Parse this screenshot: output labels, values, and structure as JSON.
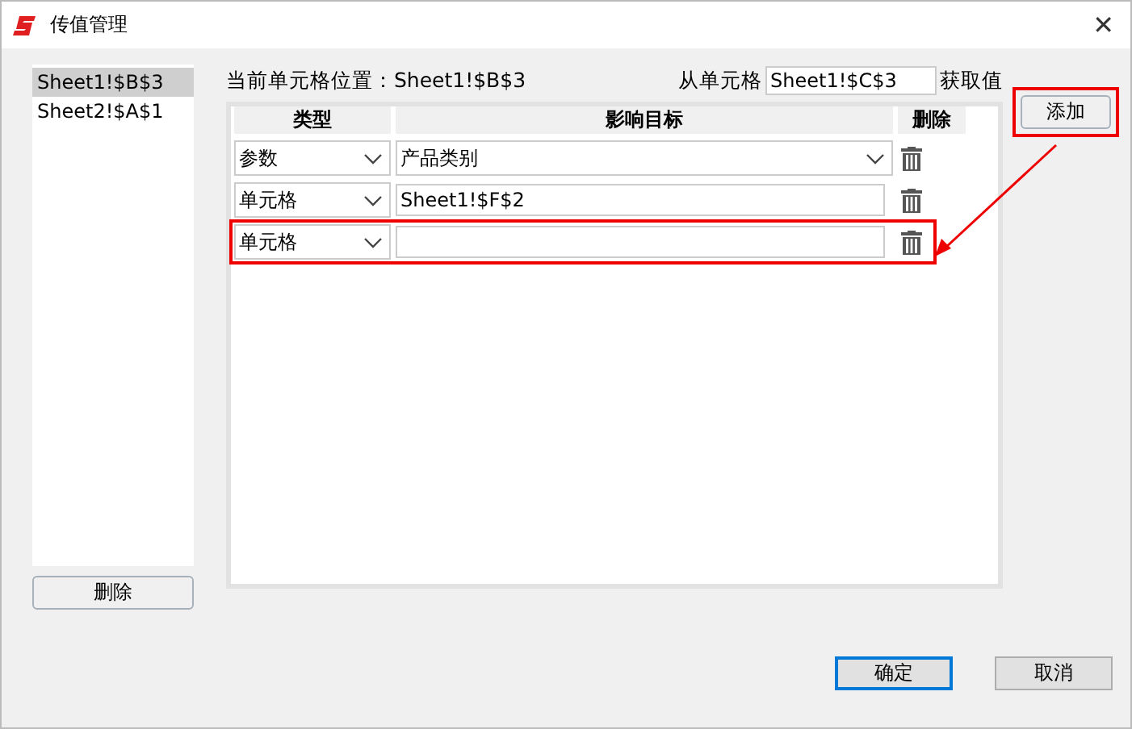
{
  "window": {
    "title": "传值管理",
    "close": "✕"
  },
  "cell_list": {
    "items": [
      {
        "label": "Sheet1!$B$3",
        "selected": true
      },
      {
        "label": "Sheet2!$A$1",
        "selected": false
      }
    ],
    "delete_button": "删除"
  },
  "current_cell": "当前单元格位置：Sheet1!$B$3",
  "source": {
    "prefix": "从单元格",
    "value": "Sheet1!$C$3",
    "suffix": "获取值"
  },
  "add_button": {
    "label": "添加",
    "highlighted": true
  },
  "table": {
    "columns": [
      "类型",
      "影响目标",
      "删除"
    ],
    "rows": [
      {
        "type": "参数",
        "kind": "dropdown",
        "target": "产品类别",
        "highlighted": false
      },
      {
        "type": "单元格",
        "kind": "text",
        "target": "Sheet1!$F$2",
        "highlighted": false
      },
      {
        "type": "单元格",
        "kind": "text",
        "target": "",
        "highlighted": true
      }
    ]
  },
  "buttons": [
    {
      "label": "确定",
      "default": true
    },
    {
      "label": "取消",
      "default": false
    }
  ]
}
